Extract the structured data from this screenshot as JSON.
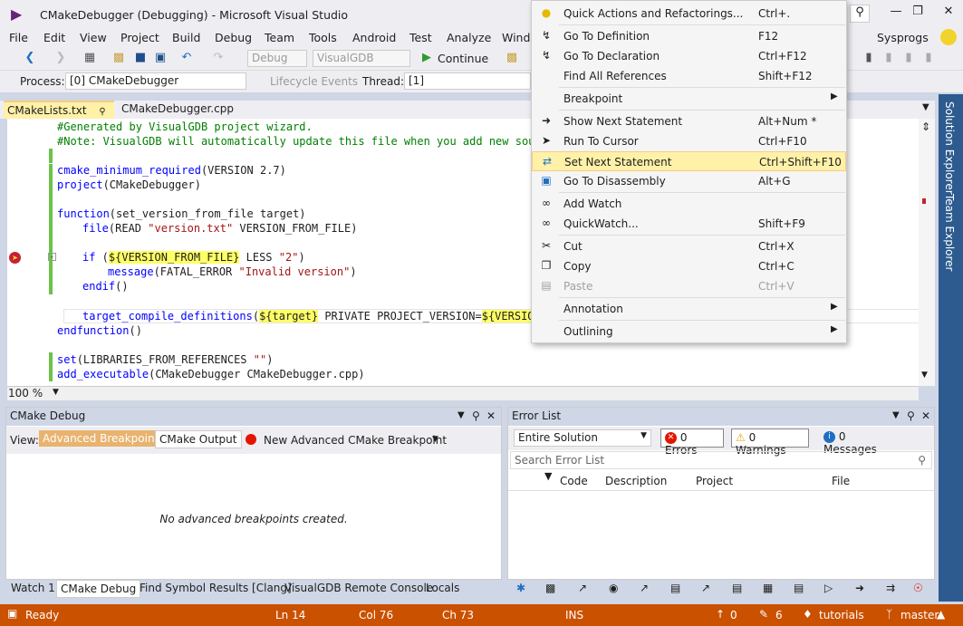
{
  "window": {
    "title": "CMakeDebugger (Debugging) - Microsoft Visual Studio",
    "user": "Sysprogs"
  },
  "menu": [
    "File",
    "Edit",
    "View",
    "Project",
    "Build",
    "Debug",
    "Team",
    "Tools",
    "Android",
    "Test",
    "Analyze",
    "Windo"
  ],
  "toolbar": {
    "config": "Debug",
    "platform": "VisualGDB",
    "continue": "Continue"
  },
  "procbar": {
    "process_label": "Process:",
    "process_value": "[0] CMakeDebugger",
    "lifecycle": "Lifecycle Events",
    "thread_label": "Thread:",
    "thread_value": "[1]"
  },
  "tabs": {
    "active": "CMakeLists.txt",
    "other": "CMakeDebugger.cpp"
  },
  "code": {
    "l1": "#Generated by VisualGDB project wizard.",
    "l2": "#Note: VisualGDB will automatically update this file when you add new sourc",
    "l3a": "cmake_minimum_required",
    "l3b": "(VERSION 2.7)",
    "l4a": "project",
    "l4b": "(CMakeDebugger)",
    "l5a": "function",
    "l5b": "(set_version_from_file target)",
    "l6a": "file",
    "l6b": "(READ ",
    "l6c": "\"version.txt\"",
    "l6d": " VERSION_FROM_FILE)",
    "l7a": "if",
    "l7b": " (",
    "l7c": "${VERSION_FROM_FILE}",
    "l7d": " LESS ",
    "l7e": "\"2\"",
    "l7f": ")",
    "l8a": "message",
    "l8b": "(FATAL_ERROR ",
    "l8c": "\"Invalid version\"",
    "l8d": ")",
    "l9a": "endif",
    "l9b": "()",
    "l10a": "target_compile_definitions",
    "l10b": "(",
    "l10c": "${target}",
    "l10d": " PRIVATE PROJECT_VERSION=",
    "l10e": "${VERSION_",
    "l11a": "endfunction",
    "l11b": "()",
    "l12a": "set",
    "l12b": "(LIBRARIES_FROM_REFERENCES ",
    "l12c": "\"\"",
    "l12d": ")",
    "l13a": "add_executable",
    "l13b": "(CMakeDebugger CMakeDebugger.cpp)"
  },
  "zoom": "100 %",
  "cmake_debug": {
    "title": "CMake Debug",
    "view_label": "View:",
    "tab1": "Advanced Breakpoints",
    "tab2": "CMake Output",
    "new_bp": "New Advanced CMake Breakpoint",
    "empty": "No advanced breakpoints created."
  },
  "error_list": {
    "title": "Error List",
    "scope": "Entire Solution",
    "errors": "0 Errors",
    "warnings": "0 Warnings",
    "messages": "0 Messages",
    "search_placeholder": "Search Error List",
    "cols": [
      "Code",
      "Description",
      "Project",
      "File"
    ]
  },
  "bottom_tabs": [
    "Watch 1",
    "CMake Debug",
    "Find Symbol Results [Clang]",
    "VisualGDB Remote Console",
    "Locals"
  ],
  "side_tabs": [
    "Solution Explorer",
    "Team Explorer"
  ],
  "status": {
    "ready": "Ready",
    "ln": "Ln 14",
    "col": "Col 76",
    "ch": "Ch 73",
    "ins": "INS",
    "up": "0",
    "edits": "6",
    "repo": "tutorials",
    "branch": "master"
  },
  "context_menu": [
    {
      "label": "Quick Actions and Refactorings...",
      "key": "Ctrl+.",
      "icon": "lightbulb-icon"
    },
    {
      "label": "Go To Definition",
      "key": "F12",
      "icon": "goto-definition-icon"
    },
    {
      "label": "Go To Declaration",
      "key": "Ctrl+F12",
      "icon": "goto-declaration-icon"
    },
    {
      "label": "Find All References",
      "key": "Shift+F12",
      "icon": ""
    },
    {
      "label": "Breakpoint",
      "key": "",
      "icon": ""
    },
    {
      "label": "Show Next Statement",
      "key": "Alt+Num *",
      "icon": "arrow-right-icon"
    },
    {
      "label": "Run To Cursor",
      "key": "Ctrl+F10",
      "icon": "cursor-icon"
    },
    {
      "label": "Set Next Statement",
      "key": "Ctrl+Shift+F10",
      "icon": "set-next-statement-icon"
    },
    {
      "label": "Go To Disassembly",
      "key": "Alt+G",
      "icon": "disassembly-icon"
    },
    {
      "label": "Add Watch",
      "key": "",
      "icon": "glasses-icon"
    },
    {
      "label": "QuickWatch...",
      "key": "Shift+F9",
      "icon": "glasses-icon"
    },
    {
      "label": "Cut",
      "key": "Ctrl+X",
      "icon": "scissors-icon"
    },
    {
      "label": "Copy",
      "key": "Ctrl+C",
      "icon": "copy-icon"
    },
    {
      "label": "Paste",
      "key": "Ctrl+V",
      "icon": "paste-icon"
    },
    {
      "label": "Annotation",
      "key": "",
      "icon": ""
    },
    {
      "label": "Outlining",
      "key": "",
      "icon": ""
    }
  ]
}
